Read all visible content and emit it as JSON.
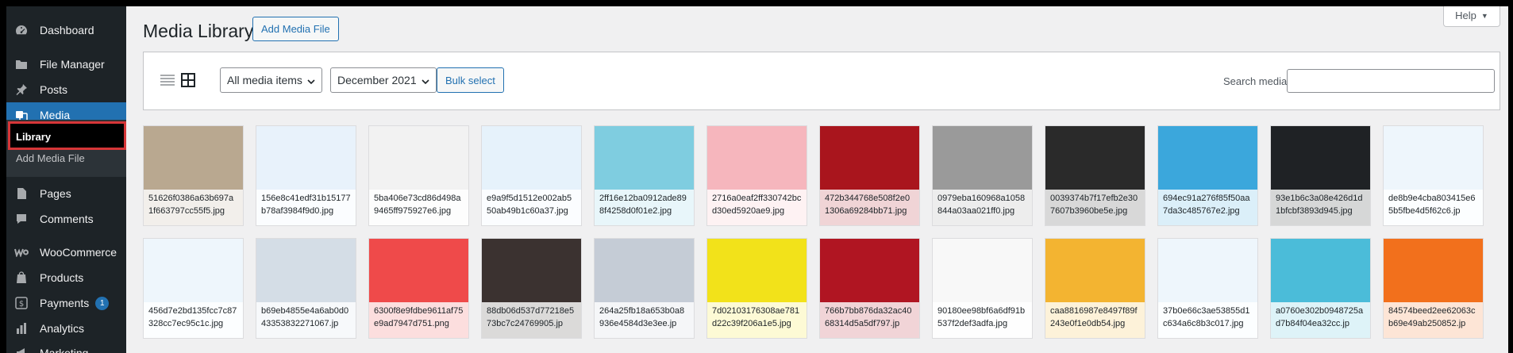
{
  "sidebar": {
    "items": [
      {
        "label": "Dashboard",
        "icon": "dashboard-icon"
      },
      {
        "label": "File Manager",
        "icon": "folder-icon"
      },
      {
        "label": "Posts",
        "icon": "pin-icon"
      },
      {
        "label": "Media",
        "icon": "media-icon"
      },
      {
        "label": "Pages",
        "icon": "page-icon"
      },
      {
        "label": "Comments",
        "icon": "comment-icon"
      },
      {
        "label": "WooCommerce",
        "icon": "woocommerce-icon"
      },
      {
        "label": "Products",
        "icon": "products-icon"
      },
      {
        "label": "Payments",
        "icon": "payments-icon",
        "badge": "1"
      },
      {
        "label": "Analytics",
        "icon": "analytics-icon"
      },
      {
        "label": "Marketing",
        "icon": "marketing-icon"
      }
    ],
    "submenu": [
      {
        "label": "Library"
      },
      {
        "label": "Add Media File"
      }
    ]
  },
  "header": {
    "title": "Media Library",
    "add_button": "Add Media File",
    "help": "Help"
  },
  "toolbar": {
    "filter_type": "All media items",
    "filter_date": "December 2021",
    "bulk_select": "Bulk select",
    "search_label": "Search media",
    "search_value": ""
  },
  "media": [
    {
      "name": "51626f0386a63b697a1f663797cc55f5.jpg",
      "bg": "#b9a890"
    },
    {
      "name": "156e8c41edf31b15177b78af3984f9d0.jpg",
      "bg": "#e8f2fb"
    },
    {
      "name": "5ba406e73cd86d498a9465ff975927e6.jpg",
      "bg": "#f2f2f2"
    },
    {
      "name": "e9a9f5d1512e002ab550ab49b1c60a37.jpg",
      "bg": "#e6f2fb"
    },
    {
      "name": "2ff16e12ba0912ade898f4258d0f01e2.jpg",
      "bg": "#7fcde0"
    },
    {
      "name": "2716a0eaf2ff330742bcd30ed5920ae9.jpg",
      "bg": "#f6b6bd"
    },
    {
      "name": "472b344768e508f2e01306a69284bb71.jpg",
      "bg": "#a9151d"
    },
    {
      "name": "0979eba160968a1058844a03aa021ff0.jpg",
      "bg": "#9a9a9a"
    },
    {
      "name": "0039374b7f17efb2e307607b3960be5e.jpg",
      "bg": "#2a2a2a"
    },
    {
      "name": "694ec91a276f85f50aa7da3c485767e2.jpg",
      "bg": "#3ba7dc"
    },
    {
      "name": "93e1b6c3a08e426d1d1bfcbf3893d945.jpg",
      "bg": "#1f2225"
    },
    {
      "name": "de8b9e4cba803415e65b5fbe4d5f62c6.jp",
      "bg": "#eef6fc"
    },
    {
      "name": "456d7e2bd135fcc7c87328cc7ec95c1c.jpg",
      "bg": "#eef6fc"
    },
    {
      "name": "b69eb4855e4a6ab0d043353832271067.jp",
      "bg": "#d4dde6"
    },
    {
      "name": "6300f8e9fdbe9611af75e9ad7947d751.png",
      "bg": "#ef4a4a"
    },
    {
      "name": "88db06d537d77218e573bc7c24769905.jp",
      "bg": "#3b3230"
    },
    {
      "name": "264a25fb18a653b0a8936e4584d3e3ee.jp",
      "bg": "#c5ccd6"
    },
    {
      "name": "7d02103176308ae781d22c39f206a1e5.jpg",
      "bg": "#f2e21a"
    },
    {
      "name": "766b7bb876da32ac4068314d5a5df797.jp",
      "bg": "#b01522"
    },
    {
      "name": "90180ee98bf6a6df91b537f2def3adfa.jpg",
      "bg": "#f8f8f8"
    },
    {
      "name": "caa8816987e8497f89f243e0f1e0db54.jpg",
      "bg": "#f3b431"
    },
    {
      "name": "37b0e66c3ae53855d1c634a6c8b3c017.jpg",
      "bg": "#eef6fc"
    },
    {
      "name": "a0760e302b0948725ad7b84f04ea32cc.jp",
      "bg": "#4bbcd9"
    },
    {
      "name": "84574beed2ee62063cb69e49ab250852.jp",
      "bg": "#f2701c"
    }
  ]
}
